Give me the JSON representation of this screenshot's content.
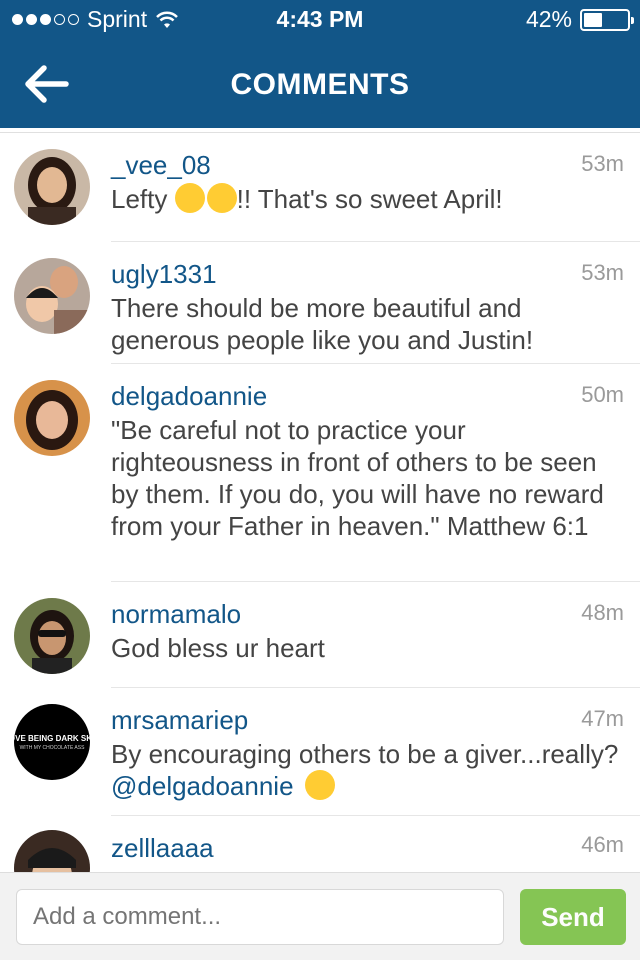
{
  "status_bar": {
    "carrier": "Sprint",
    "time": "4:43 PM",
    "battery": "42%",
    "battery_level": 0.42
  },
  "nav": {
    "title": "COMMENTS"
  },
  "comments": [
    {
      "username": "_vee_08",
      "time": "53m",
      "text_before": "Lefty ",
      "text_after": "!! That's so sweet April!",
      "emojis": [
        "raised-hands-emoji",
        "thumbs-up-emoji"
      ]
    },
    {
      "username": "ugly1331",
      "time": "53m",
      "text": "There should be more beautiful and generous people like you and Justin!"
    },
    {
      "username": "delgadoannie",
      "time": "50m",
      "text": "\"Be careful not to practice your righteousness in front of others to be seen by them. If you do, you will have no reward from your Father in heaven.\" Matthew 6:1"
    },
    {
      "username": "normamalo",
      "time": "48m",
      "text": "God bless ur heart"
    },
    {
      "username": "mrsamariep",
      "time": "47m",
      "text": "By encouraging others to be a giver...really? ",
      "mention": "@delgadoannie",
      "emoji": "unamused-face-emoji",
      "avatar_text_1": "LOVE BEING DARK SKIN",
      "avatar_text_2": "WITH MY CHOCOLATE ASS"
    },
    {
      "username": "zelllaaaa",
      "time": "46m"
    }
  ],
  "composer": {
    "placeholder": "Add a comment...",
    "send_label": "Send"
  },
  "colors": {
    "header": "#125688",
    "username": "#125688",
    "send": "#7ac143"
  }
}
